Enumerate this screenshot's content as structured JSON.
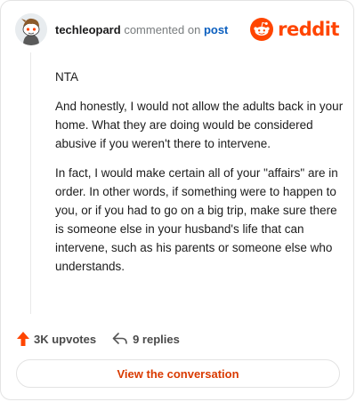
{
  "header": {
    "username": "techleopard",
    "commented_text": "commented on",
    "post_link": "post",
    "brand": "reddit"
  },
  "comment": {
    "paragraphs": [
      "NTA",
      "And honestly, I would not allow the adults back in your home. What they are doing would be considered abusive if you weren't there to intervene.",
      "In fact, I would make certain all of your \"affairs\" are in order. In other words, if something were to happen to you, or if you had to go on a big trip, make sure there is someone else in your husband's life that can intervene, such as his parents or someone else who understands."
    ]
  },
  "actions": {
    "upvotes": "3K upvotes",
    "replies": "9 replies",
    "view_button": "View the conversation"
  },
  "icons": {
    "avatar": "snoo-avatar",
    "brand": "reddit-logo-icon",
    "upvote": "upvote-arrow-icon",
    "reply": "reply-arrow-icon"
  },
  "colors": {
    "brand": "#ff4500",
    "link": "#0b5fbf",
    "button_text": "#d93a00",
    "upvote_arrow": "#ff4500"
  }
}
